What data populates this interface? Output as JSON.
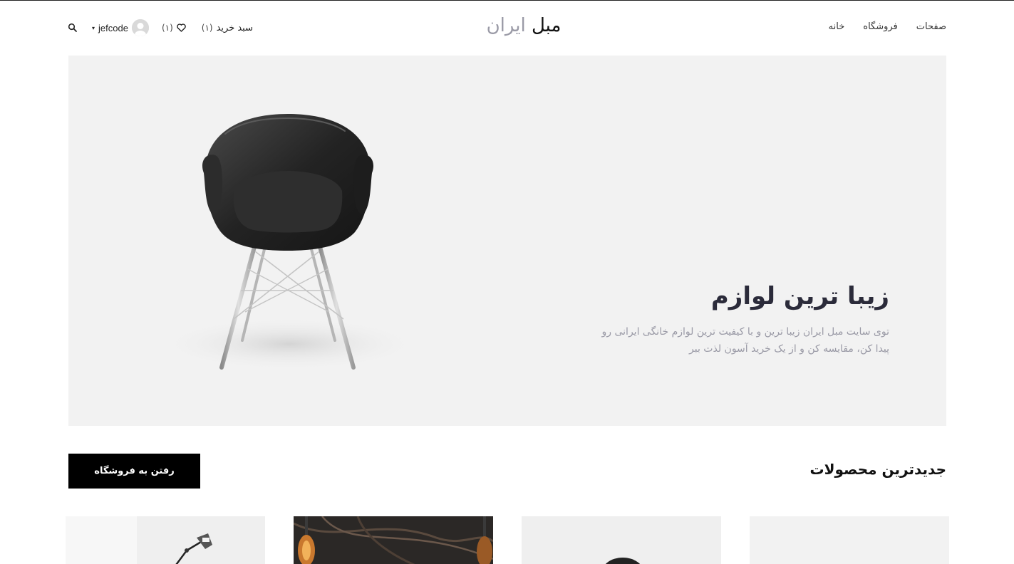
{
  "header": {
    "nav": [
      {
        "label": "خانه"
      },
      {
        "label": "فروشگاه"
      },
      {
        "label": "صفحات"
      }
    ],
    "logo": {
      "part1": "مبل",
      "part2": "ایران"
    },
    "cart": {
      "label": "سبد خرید",
      "count": "(۱)"
    },
    "wishlist": {
      "count": "(۱)",
      "icon": "heart-icon"
    },
    "user": {
      "name": "jefcode",
      "caret": "▾"
    },
    "search": {
      "icon": "search-icon"
    }
  },
  "hero": {
    "title": "زیبا ترین لوازم",
    "subtitle_line1": "توی سایت مبل ایران زیبا ترین و با کیفیت ترین لوازم خانگی ایرانی رو",
    "subtitle_line2": "پیدا کن، مقایسه کن و از یک خرید آسون لذت ببر"
  },
  "newest": {
    "title": "جدیدترین محصولات",
    "button_label": "رفتن به فروشگاه"
  },
  "colors": {
    "hero_bg": "#f2f2f2",
    "button_bg": "#000000",
    "accent_gray": "#9a9aa6"
  }
}
